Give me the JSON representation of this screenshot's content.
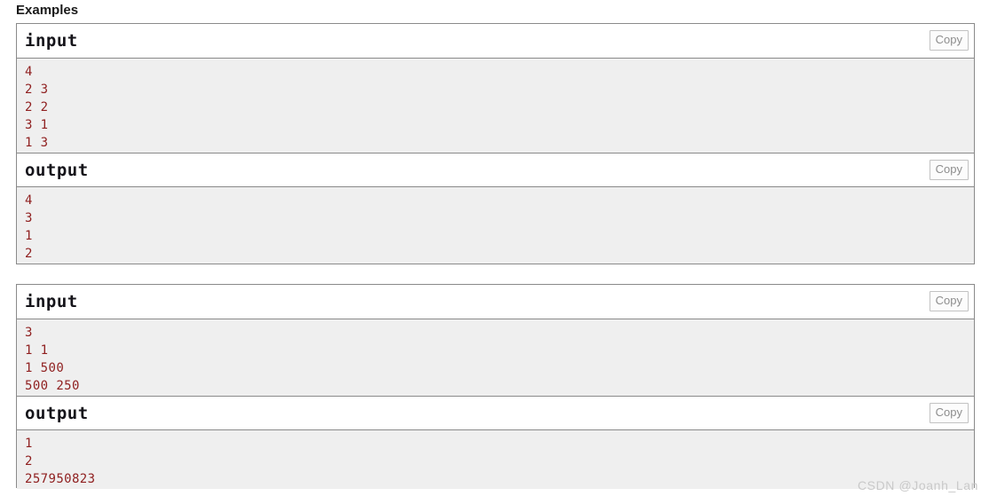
{
  "section": {
    "title": "Examples"
  },
  "copy_label": "Copy",
  "colors": {
    "code_text": "#8f1f1f",
    "code_background": "#efefef",
    "block_border": "#8a8a8a",
    "copy_border": "#c2c2c2",
    "copy_text": "#8d8d8d",
    "watermark": "#c9c9c9"
  },
  "examples": [
    {
      "input": {
        "label": "input",
        "copy_label": "Copy",
        "lines": [
          "4",
          "2 3",
          "2 2",
          "3 1",
          "1 3"
        ]
      },
      "output": {
        "label": "output",
        "copy_label": "Copy",
        "lines": [
          "4",
          "3",
          "1",
          "2"
        ]
      }
    },
    {
      "input": {
        "label": "input",
        "copy_label": "Copy",
        "lines": [
          "3",
          "1 1",
          "1 500",
          "500 250"
        ]
      },
      "output": {
        "label": "output",
        "copy_label": "Copy",
        "lines": [
          "1",
          "2",
          "257950823"
        ]
      }
    }
  ],
  "watermark": {
    "text": "CSDN @Joanh_Lan"
  }
}
